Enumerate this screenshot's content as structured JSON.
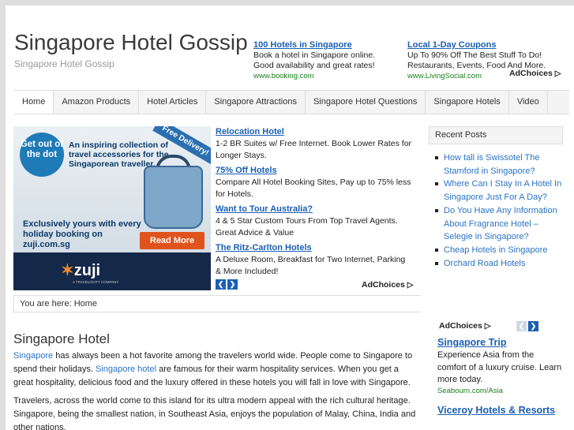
{
  "header": {
    "title": "Singapore Hotel Gossip",
    "description": "Singapore Hotel Gossip",
    "ads": [
      {
        "title": "100 Hotels in Singapore",
        "desc": "Book a hotel in Singapore online. Good availability and great rates!",
        "url": "www.booking.com"
      },
      {
        "title": "Local 1-Day Coupons",
        "desc": "Up To 90% Off The Best Stuff To Do! Restaurants, Events, Food And More.",
        "url": "www.LivingSocial.com"
      }
    ],
    "adchoices": "AdChoices"
  },
  "nav": {
    "items": [
      "Home",
      "Amazon Products",
      "Hotel Articles",
      "Singapore Attractions",
      "Singapore Hotel Questions",
      "Singapore Hotels",
      "Video"
    ]
  },
  "banner": {
    "badge": "Get out of the dot",
    "headline": "An inspiring collection of travel accessories for the Singaporean traveller.",
    "ribbon": "Free Delivery!",
    "exclusive": "Exclusively yours with every holiday booking on zuji.com.sg",
    "cta": "Read More",
    "logo": "zuji",
    "logo_sub": "A TRAVELOCITY COMPANY"
  },
  "ads": {
    "items": [
      {
        "title": "Relocation Hotel",
        "desc": "1-2 BR Suites w/ Free Internet. Book Lower Rates for Longer Stays."
      },
      {
        "title": "75% Off Hotels",
        "desc": "Compare All Hotel Booking Sites, Pay up to 75% less for Hotels."
      },
      {
        "title": "Want to Tour Australia?",
        "desc": "4 & 5 Star Custom Tours From Top Travel Agents. Great Advice & Value"
      },
      {
        "title": "The Ritz-Carlton Hotels",
        "desc": "A Deluxe Room, Breakfast for Two Internet, Parking & More Included!"
      }
    ],
    "adchoices": "AdChoices",
    "prev": "❮",
    "next": "❯"
  },
  "breadcrumb": "You are here: Home",
  "post": {
    "title": "Singapore Hotel",
    "p1_link1": "Singapore",
    "p1_text1": " has always been a hot favorite among the travelers world wide. People come to Singapore to spend their holidays. ",
    "p1_link2": "Singapore hotel",
    "p1_text2": " are famous for their warm hospitality services. When you get a great hospitality, delicious food and the luxury offered in these hotels you will fall in love with Singapore.",
    "p2": "Travelers, across the world come to this island for its ultra modern appeal with the rich cultural heritage. Singapore, being the smallest nation, in Southeast Asia, enjoys the population of Malay, China, India and other nations."
  },
  "sidebar": {
    "recent_title": "Recent Posts",
    "recent": [
      "How tall is Swissotel The Stamford in Singapore?",
      "Where Can I Stay In A Hotel In Singapore Just For A Day?",
      "Do You Have Any Information About Fragrance Hotel – Selegie in Singapore?",
      "Cheap Hotels in Singapore",
      "Orchard Road Hotels"
    ],
    "adchoices": "AdChoices",
    "ads": [
      {
        "title": "Singapore Trip",
        "desc": "Experience Asia from the comfort of a luxury cruise. Learn more today.",
        "url": "Seabourn.com/Asia"
      },
      {
        "title": "Viceroy Hotels & Resorts",
        "desc": "",
        "url": ""
      }
    ]
  },
  "colors": {
    "link": "#2a73c6",
    "ad_title": "#1a5fb4",
    "ad_url": "#1a7f1a",
    "cta": "#e0531c"
  }
}
